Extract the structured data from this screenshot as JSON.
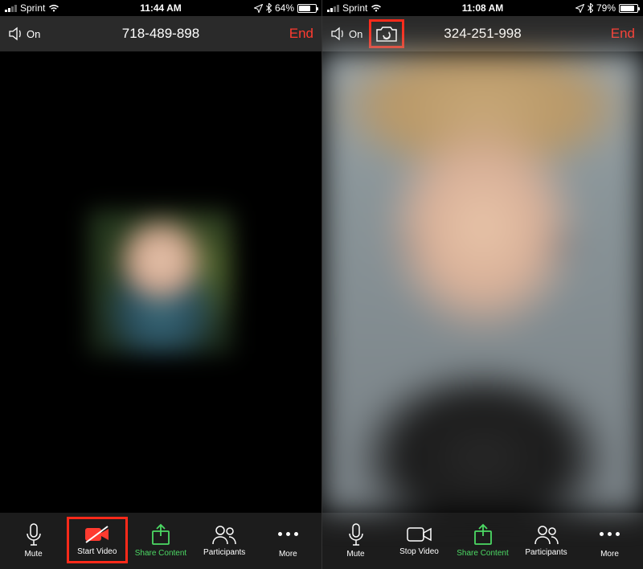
{
  "left": {
    "status": {
      "carrier": "Sprint",
      "time": "11:44 AM",
      "battery_pct": "64%",
      "battery_fill_pct": 64
    },
    "header": {
      "speaker_label": "On",
      "meeting_id": "718-489-898",
      "end_label": "End"
    },
    "toolbar": {
      "mute": "Mute",
      "video": "Start Video",
      "share": "Share Content",
      "participants": "Participants",
      "more": "More"
    }
  },
  "right": {
    "status": {
      "carrier": "Sprint",
      "time": "11:08 AM",
      "battery_pct": "79%",
      "battery_fill_pct": 79
    },
    "header": {
      "speaker_label": "On",
      "meeting_id": "324-251-998",
      "end_label": "End"
    },
    "toolbar": {
      "mute": "Mute",
      "video": "Stop Video",
      "share": "Share Content",
      "participants": "Participants",
      "more": "More"
    }
  },
  "colors": {
    "accent_red": "#ff3b30",
    "accent_green": "#4cd964",
    "highlight": "#ff2a1a"
  }
}
